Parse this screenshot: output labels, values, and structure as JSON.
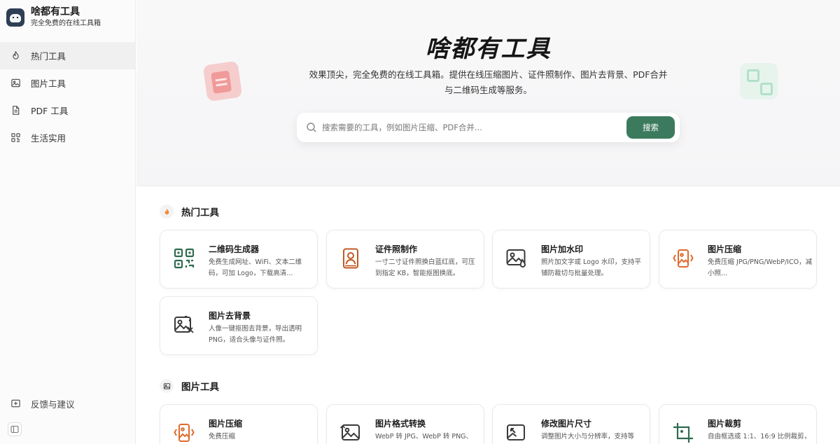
{
  "brand": {
    "title": "啥都有工具",
    "subtitle": "完全免费的在线工具箱"
  },
  "sidebar": {
    "items": [
      {
        "label": "热门工具",
        "icon": "flame-icon",
        "active": true
      },
      {
        "label": "图片工具",
        "icon": "image-icon",
        "active": false
      },
      {
        "label": "PDF 工具",
        "icon": "document-icon",
        "active": false
      },
      {
        "label": "生活实用",
        "icon": "qrcode-icon",
        "active": false
      }
    ],
    "feedback_label": "反馈与建议"
  },
  "hero": {
    "title": "啥都有工具",
    "desc_line1": "效果顶尖，完全免费的在线工具箱。提供在线压缩图片、证件照制作、图片去背景、PDF合并",
    "desc_line2": "与二维码生成等服务。"
  },
  "search": {
    "placeholder": "搜索需要的工具，例如图片压缩、PDF合并...",
    "button_label": "搜索"
  },
  "sections": {
    "hot": {
      "title": "热门工具",
      "cards": [
        {
          "title": "二维码生成器",
          "desc": "免费生成网址、WiFi、文本二维码，可加 Logo，下载高清...",
          "icon": "qrcode-icon"
        },
        {
          "title": "证件照制作",
          "desc": "一寸二寸证件照换白蓝红底，可压到指定 KB，智能抠图换底。",
          "icon": "id-photo-icon"
        },
        {
          "title": "图片加水印",
          "desc": "照片加文字或 Logo 水印，支持平铺防裁切与批量处理。",
          "icon": "watermark-icon"
        },
        {
          "title": "图片压缩",
          "desc": "免费压缩 JPG/PNG/WebP/ICO，减小照...",
          "icon": "compress-icon"
        },
        {
          "title": "图片去背景",
          "desc": "人像一键抠图去背景，导出透明 PNG，适合头像与证件照。",
          "icon": "remove-bg-icon"
        }
      ]
    },
    "image": {
      "title": "图片工具",
      "cards": [
        {
          "title": "图片压缩",
          "desc": "免费压缩",
          "icon": "compress-icon"
        },
        {
          "title": "图片格式转换",
          "desc": "WebP 转 JPG、WebP 转 PNG、",
          "icon": "convert-icon"
        },
        {
          "title": "修改图片尺寸",
          "desc": "调整图片大小与分辨率，支持等",
          "icon": "resize-icon"
        },
        {
          "title": "图片裁剪",
          "desc": "自由框选或 1:1、16:9 比例裁剪，",
          "icon": "crop-icon"
        }
      ]
    }
  },
  "colors": {
    "accent": "#3c7a5d",
    "orange": "#e06a2c",
    "green": "#2e6b4f"
  }
}
